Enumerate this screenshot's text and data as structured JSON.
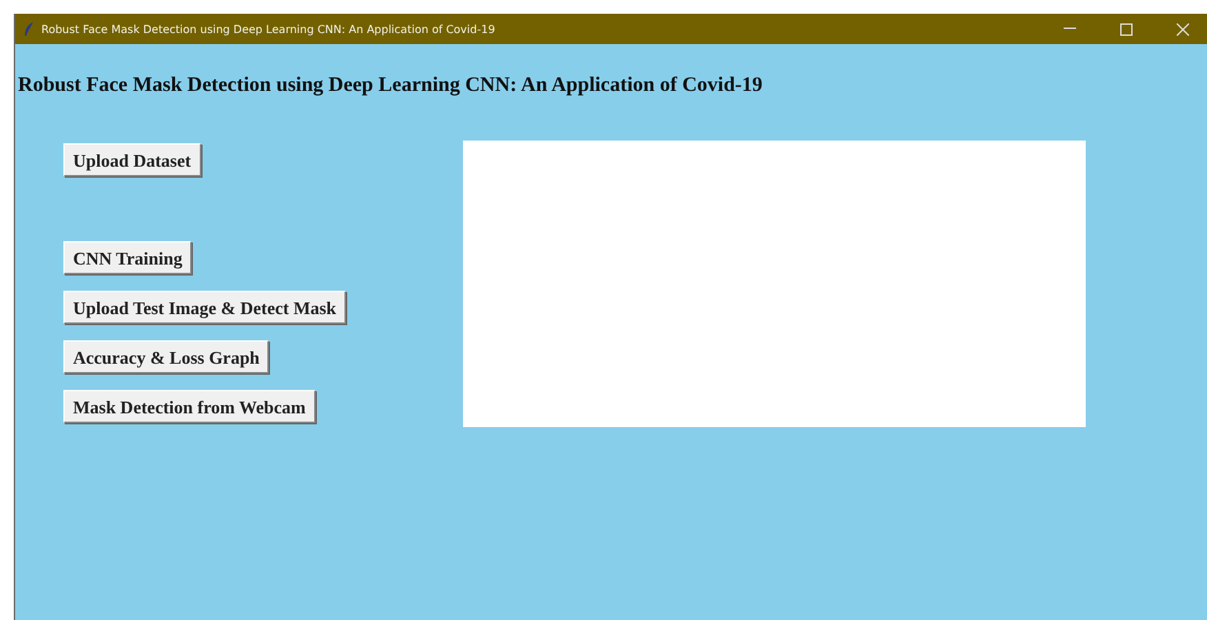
{
  "window": {
    "title": "Robust Face Mask Detection using Deep Learning CNN: An Application of Covid-19"
  },
  "heading": "Robust Face Mask Detection using Deep Learning CNN: An Application of Covid-19",
  "buttons": [
    {
      "label": "Upload Dataset"
    },
    {
      "label": "CNN Training"
    },
    {
      "label": "Upload Test Image & Detect Mask"
    },
    {
      "label": "Accuracy & Loss Graph"
    },
    {
      "label": "Mask Detection from Webcam"
    }
  ],
  "output": {
    "kind": "text-area"
  }
}
